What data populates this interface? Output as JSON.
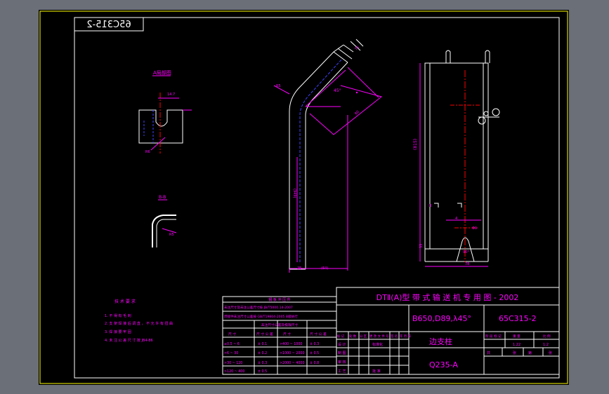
{
  "colors": {
    "viewport_bg": "#6b6f78",
    "sheet_bg": "#000000",
    "frame": "#ffff00",
    "geometry": "#ffffff",
    "dims": "#ff00ff",
    "hidden": "#4040ff",
    "centerline": "#ff0000"
  },
  "drawing_number_mirrored": "65C315-2",
  "view_labels": {
    "detail_a": "A局部图",
    "section_bb": "B-B"
  },
  "bend_view": {
    "angle_label": "45°",
    "dim_length": "(949)",
    "dim_width_bottom": "(64)",
    "dim_left": "25",
    "dim_radius": "R5",
    "dim_top": "75",
    "dim_seg": "80"
  },
  "side_view": {
    "dim_height": "(815)",
    "dim_width": "78",
    "dim_base": "33",
    "dim_hole": "Φ9",
    "angle_bottom": "90°",
    "section_mark": "B",
    "dim_small": "4"
  },
  "detail_dims": {
    "d1": "14.7",
    "d2": "R6"
  },
  "notes": {
    "title": "技 术 要 求",
    "lines": [
      "1. 不 得 有 毛 刺",
      "2. 支 架 焊 接 后 调 直 ， 不 允 许 有 扭 曲",
      "3. 焊 接 要 牢 固",
      "4. 未 注 公 差 尺 寸 按 JB4-86"
    ]
  },
  "tolerance_table": {
    "title": "钢 板 冲 压 件",
    "row1": "未注尺寸及未注公差尺寸按 JB/T5000.14-2007",
    "row2": "焊接件未注尺寸公差按 GB/T19804-2005 B级执行",
    "subtitle": "未注尺寸公差及极限尺寸",
    "headers": [
      "尺 寸",
      "尺 寸 公 差",
      "尺 寸",
      "尺 寸 公 差"
    ],
    "rows": [
      [
        "≥0.5 ~ 6",
        "± 0.1",
        ">400 ~ 1000",
        "± 0.3"
      ],
      [
        ">6 ~ 30",
        "± 0.2",
        ">1000 ~ 2000",
        "± 0.5"
      ],
      [
        ">30 ~ 120",
        "± 0.3",
        ">2000 ~ 4000",
        "± 0.8"
      ],
      [
        ">120 ~ 400",
        "± 0.5",
        "",
        ""
      ]
    ]
  },
  "title_block": {
    "main_title": "DTⅡ(A)型  带 式 输 送 机 专 用 图 - 2002",
    "spec": "B650,D89,λ45°",
    "drawing_no": "65C315-2",
    "part_name": "边支柱",
    "material": "Q235-A",
    "sign_headers": [
      "标 记",
      "处 数",
      "分 区",
      "更 改 文 件 号",
      "签 名",
      "年 月 日"
    ],
    "sign_roles": [
      "设 计",
      "制 图",
      "审 核",
      "工 艺"
    ],
    "roles_right": [
      "标准化",
      "批 准"
    ],
    "stage_headers": [
      "阶 段 标 记",
      "重 量",
      "比 例"
    ],
    "scale": "1:2",
    "weight": "1.22",
    "sheet_info": [
      "共",
      "张",
      "第",
      "张"
    ]
  }
}
